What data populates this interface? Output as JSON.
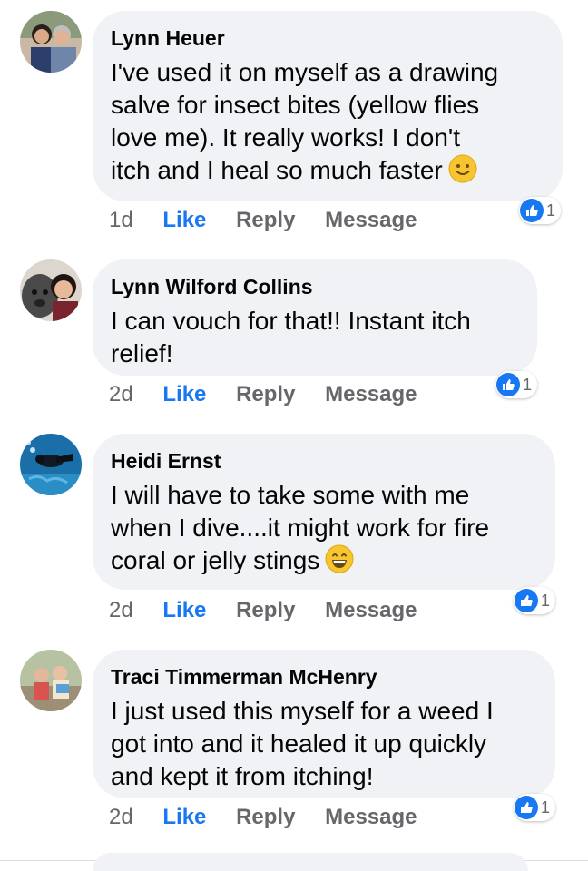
{
  "comments": [
    {
      "author": "Lynn Heuer",
      "text": "I've used it on myself as a drawing\nsalve for insect bites (yellow flies\nlove me). It really works! I don't\nitch and I heal so much faster",
      "emoji": "slightly-smiling-face",
      "time": "1d",
      "like_label": "Like",
      "reply_label": "Reply",
      "message_label": "Message",
      "reaction_count": "1"
    },
    {
      "author": "Lynn Wilford Collins",
      "text": "I can vouch for that!! Instant itch\nrelief!",
      "time": "2d",
      "like_label": "Like",
      "reply_label": "Reply",
      "message_label": "Message",
      "reaction_count": "1"
    },
    {
      "author": "Heidi Ernst",
      "text": "I will have to take some with me\nwhen I dive....it might work for fire\ncoral or jelly stings",
      "emoji": "grinning-face",
      "time": "2d",
      "like_label": "Like",
      "reply_label": "Reply",
      "message_label": "Message",
      "reaction_count": "1"
    },
    {
      "author": "Traci Timmerman McHenry",
      "text": "I just used this myself for a weed I\ngot into and it healed it up quickly\nand kept it from itching!",
      "time": "2d",
      "like_label": "Like",
      "reply_label": "Reply",
      "message_label": "Message",
      "reaction_count": "1"
    }
  ],
  "colors": {
    "bubble": "#f0f2f5",
    "like": "#1877f2",
    "meta": "#65676b"
  }
}
